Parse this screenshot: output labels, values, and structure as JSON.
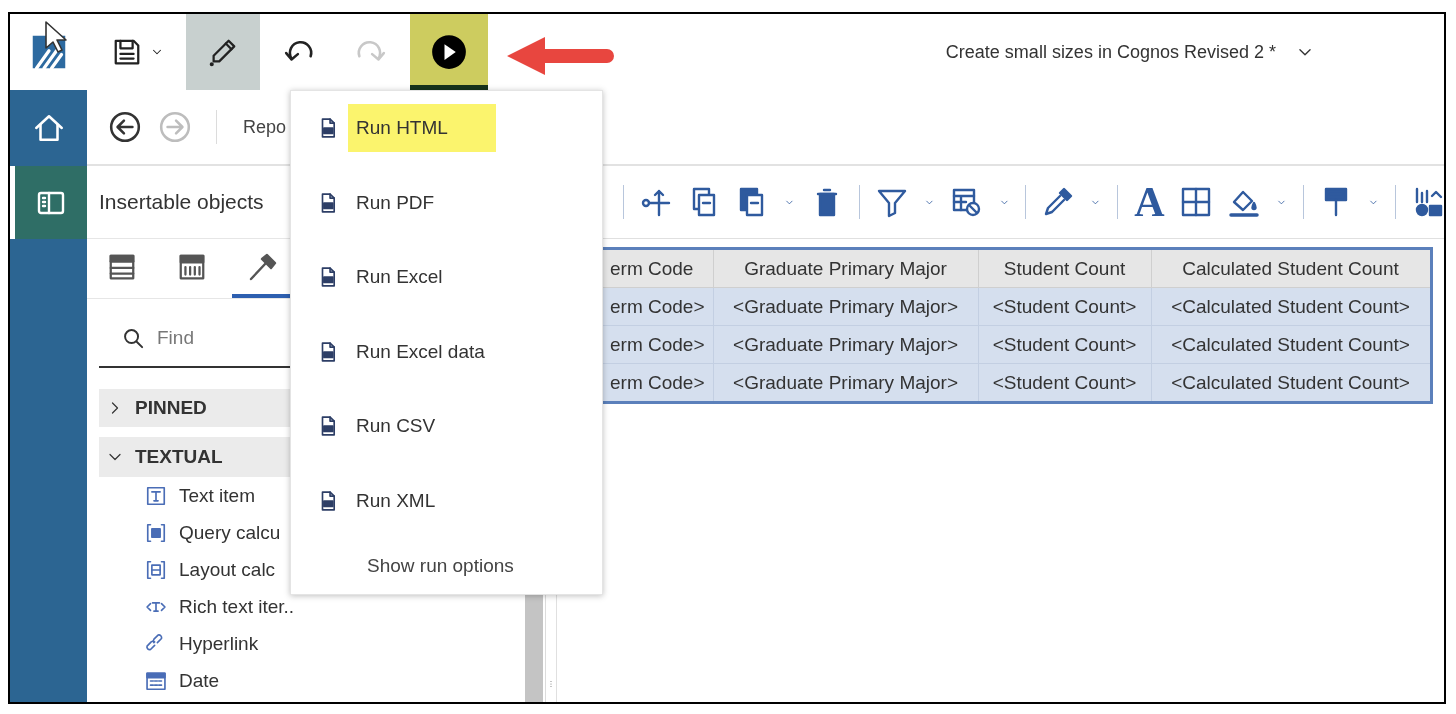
{
  "app_bar": {
    "buttons": [
      {
        "kind": "save",
        "selected": false,
        "expanded": false,
        "disabled": false
      },
      {
        "kind": "edit",
        "selected": true,
        "expanded": false,
        "disabled": false
      },
      {
        "kind": "undo",
        "selected": false,
        "expanded": false,
        "disabled": false
      },
      {
        "kind": "redo",
        "selected": false,
        "expanded": false,
        "disabled": true
      },
      {
        "kind": "run",
        "selected": false,
        "expanded": true,
        "disabled": false
      }
    ],
    "document_title": "Create small sizes in Cognos Revised 2 *"
  },
  "side_rail": [
    {
      "kind": "home",
      "selected": false
    },
    {
      "kind": "panel",
      "selected": true
    }
  ],
  "nav": {
    "buttons": [
      {
        "kind": "back",
        "disabled": false
      },
      {
        "kind": "forward",
        "disabled": true
      }
    ],
    "breadcrumb": "Repo"
  },
  "panel": {
    "title": "Insertable objects",
    "tabs": [
      {
        "kind": "rows",
        "selected": false
      },
      {
        "kind": "grid",
        "selected": false
      },
      {
        "kind": "hammer",
        "selected": true
      }
    ],
    "search": {
      "placeholder": "Find"
    },
    "groups": [
      {
        "label": "PINNED",
        "expanded": false
      },
      {
        "label": "TEXTUAL",
        "expanded": true,
        "children": [
          {
            "kind": "text",
            "label": "Text item"
          },
          {
            "kind": "query",
            "label": "Query calcu"
          },
          {
            "kind": "layout",
            "label": "Layout calc"
          },
          {
            "kind": "rich",
            "label": "Rich text iter.."
          },
          {
            "kind": "link",
            "label": "Hyperlink"
          },
          {
            "kind": "date",
            "label": "Date"
          }
        ]
      }
    ]
  },
  "format_toolbar": {
    "font_glyph": "A"
  },
  "table": {
    "columns": [
      "erm Code",
      "Graduate Primary Major",
      "Student Count",
      "Calculated Student Count"
    ],
    "rows": [
      [
        "erm Code>",
        "<Graduate Primary Major>",
        "<Student Count>",
        "<Calculated Student Count>"
      ],
      [
        "erm Code>",
        "<Graduate Primary Major>",
        "<Student Count>",
        "<Calculated Student Count>"
      ],
      [
        "erm Code>",
        "<Graduate Primary Major>",
        "<Student Count>",
        "<Calculated Student Count>"
      ]
    ]
  },
  "run_menu": {
    "items": [
      {
        "label": "Run HTML",
        "selected": true
      },
      {
        "label": "Run PDF",
        "selected": false
      },
      {
        "label": "Run Excel",
        "selected": false
      },
      {
        "label": "Run Excel data",
        "selected": false
      },
      {
        "label": "Run CSV",
        "selected": false
      },
      {
        "label": "Run XML",
        "selected": false
      }
    ],
    "footer": "Show run options"
  }
}
